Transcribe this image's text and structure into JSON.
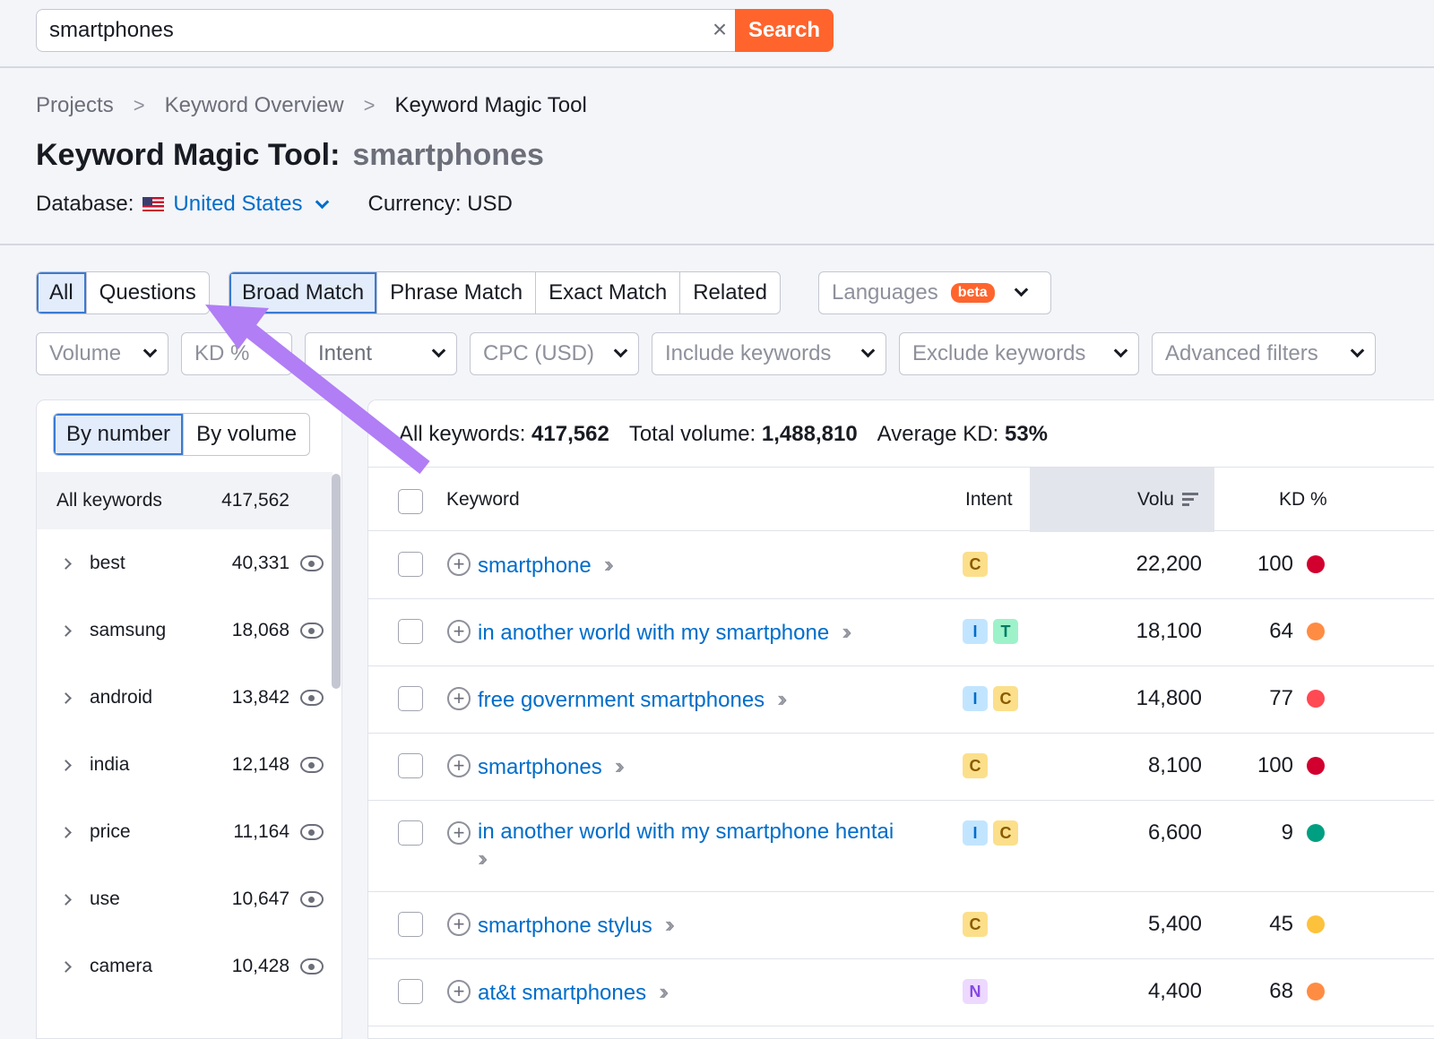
{
  "search": {
    "value": "smartphones",
    "clear": "×",
    "button": "Search"
  },
  "breadcrumb": [
    "Projects",
    "Keyword Overview",
    "Keyword Magic Tool"
  ],
  "breadcrumb_separator": ">",
  "title": {
    "label": "Keyword Magic Tool:",
    "query": "smartphones"
  },
  "database": {
    "label": "Database:",
    "value": "United States",
    "currency": "Currency: USD"
  },
  "tabs_left": [
    "All",
    "Questions"
  ],
  "tabs_match": [
    "Broad Match",
    "Phrase Match",
    "Exact Match",
    "Related"
  ],
  "languages": {
    "label": "Languages",
    "badge": "beta"
  },
  "filters": [
    "Volume",
    "KD %",
    "Intent",
    "CPC (USD)",
    "Include keywords",
    "Exclude keywords",
    "Advanced filters"
  ],
  "groups": {
    "toggle": [
      "By number",
      "By volume"
    ],
    "all": {
      "label": "All keywords",
      "count": "417,562"
    },
    "items": [
      {
        "name": "best",
        "count": "40,331"
      },
      {
        "name": "samsung",
        "count": "18,068"
      },
      {
        "name": "android",
        "count": "13,842"
      },
      {
        "name": "india",
        "count": "12,148"
      },
      {
        "name": "price",
        "count": "11,164"
      },
      {
        "name": "use",
        "count": "10,647"
      },
      {
        "name": "camera",
        "count": "10,428"
      }
    ]
  },
  "summary": {
    "all_label": "All keywords:",
    "all_value": "417,562",
    "volume_label": "Total volume:",
    "volume_value": "1,488,810",
    "kd_label": "Average KD:",
    "kd_value": "53%"
  },
  "columns": {
    "keyword": "Keyword",
    "intent": "Intent",
    "volume": "Volu",
    "kd": "KD %"
  },
  "rows": [
    {
      "keyword": "smartphone",
      "intents": [
        "C"
      ],
      "volume": "22,200",
      "kd": "100",
      "kd_color": "#d1002f"
    },
    {
      "keyword": "in another world with my smartphone",
      "intents": [
        "I",
        "T"
      ],
      "volume": "18,100",
      "kd": "64",
      "kd_color": "#ff8c43"
    },
    {
      "keyword": "free government smartphones",
      "intents": [
        "I",
        "C"
      ],
      "volume": "14,800",
      "kd": "77",
      "kd_color": "#ff4953"
    },
    {
      "keyword": "smartphones",
      "intents": [
        "C"
      ],
      "volume": "8,100",
      "kd": "100",
      "kd_color": "#d1002f"
    },
    {
      "keyword": "in another world with my smartphone hentai",
      "intents": [
        "I",
        "C"
      ],
      "volume": "6,600",
      "kd": "9",
      "kd_color": "#009f81"
    },
    {
      "keyword": "smartphone stylus",
      "intents": [
        "C"
      ],
      "volume": "5,400",
      "kd": "45",
      "kd_color": "#fdc23c"
    },
    {
      "keyword": "at&t smartphones",
      "intents": [
        "N"
      ],
      "volume": "4,400",
      "kd": "68",
      "kd_color": "#ff8c43"
    }
  ],
  "intent_colors": {
    "C": {
      "bg": "#fcdf8b",
      "fg": "#8a5a00"
    },
    "I": {
      "bg": "#c2e5ff",
      "fg": "#006dca"
    },
    "T": {
      "bg": "#9ef2c9",
      "fg": "#007c65"
    },
    "N": {
      "bg": "#edd9ff",
      "fg": "#8649e1"
    }
  },
  "colors": {
    "accent": "#ff642d",
    "link": "#006dca",
    "annotation_arrow": "#b17ef5"
  }
}
